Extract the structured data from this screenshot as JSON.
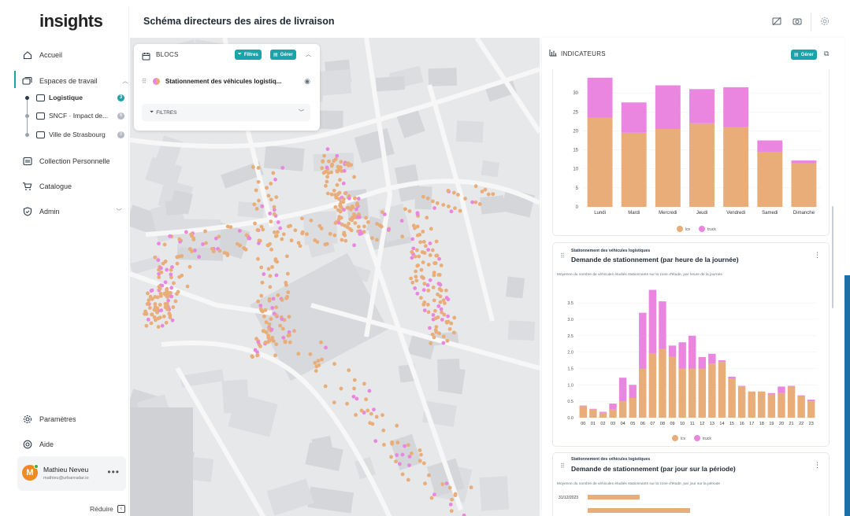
{
  "app": {
    "logo": "insights",
    "page_title": "Schéma directeurs des aires de livraison"
  },
  "sidebar": {
    "items": [
      {
        "label": "Accueil"
      },
      {
        "label": "Espaces de travail"
      },
      {
        "label": "Collection Personnelle"
      },
      {
        "label": "Catalogue"
      },
      {
        "label": "Admin"
      }
    ],
    "workspaces": [
      {
        "label": "Logistique",
        "badge": "3",
        "active": true
      },
      {
        "label": "SNCF · Impact de...",
        "badge": "6",
        "active": false
      },
      {
        "label": "Ville de Strasbourg",
        "badge": "0",
        "active": false
      }
    ],
    "bottom": [
      {
        "label": "Paramètres"
      },
      {
        "label": "Aide"
      }
    ],
    "user": {
      "initial": "M",
      "name": "Mathieu Neveu",
      "email": "mathieu@urbanradar.io"
    },
    "collapse_label": "Réduire"
  },
  "blocs": {
    "title": "BLOCS",
    "filters_btn": "Filtres",
    "manage_btn": "Gérer",
    "layer_name": "Stationnement des véhicules logistiq...",
    "filters_label": "FILTRES"
  },
  "indicators": {
    "title": "INDICATEURS",
    "manage_btn": "Gérer",
    "colors": {
      "lcv": "#e8ad78",
      "truck": "#ea86e0"
    },
    "legend": {
      "lcv": "lcv",
      "truck": "truck"
    },
    "card2": {
      "subtitle": "Stationnement des véhicules logistiques",
      "title": "Demande de stationnement (par heure de la journée)",
      "description": "Moyenne du nombre de véhicules étudiés stationnants sur la zone d'étude, par heure de la journée"
    },
    "card3": {
      "subtitle": "Stationnement des véhicules logistiques",
      "title": "Demande de stationnement (par jour sur la période)",
      "description": "Moyenne du nombre de véhicules étudiés stationnants sur la zone d'étude, par jour sur la période",
      "first_row_label": "31/12/2023",
      "first_row_value": 36
    }
  },
  "chart_data": [
    {
      "type": "bar",
      "stacked": true,
      "categories": [
        "Lundi",
        "Mardi",
        "Mercredi",
        "Jeudi",
        "Vendredi",
        "Samedi",
        "Dimanche"
      ],
      "series": [
        {
          "name": "lcv",
          "values": [
            23.5,
            19.5,
            20.5,
            22,
            21,
            14.5,
            11.5
          ]
        },
        {
          "name": "truck",
          "values": [
            10.5,
            8,
            11.5,
            9,
            10.5,
            3,
            0.7
          ]
        }
      ],
      "yticks": [
        0,
        5,
        10,
        15,
        20,
        25,
        30
      ],
      "ylim": [
        0,
        35
      ],
      "legend": "bottom"
    },
    {
      "type": "bar",
      "stacked": true,
      "categories": [
        "00",
        "01",
        "02",
        "03",
        "04",
        "05",
        "06",
        "07",
        "08",
        "09",
        "10",
        "11",
        "12",
        "13",
        "14",
        "15",
        "16",
        "17",
        "18",
        "19",
        "20",
        "21",
        "22",
        "23"
      ],
      "series": [
        {
          "name": "lcv",
          "values": [
            0.35,
            0.25,
            0.15,
            0.25,
            0.5,
            0.6,
            1.5,
            1.95,
            2.1,
            1.85,
            1.5,
            1.5,
            1.5,
            1.65,
            1.7,
            1.2,
            0.95,
            0.8,
            0.8,
            0.7,
            0.75,
            0.95,
            0.65,
            0.5
          ]
        },
        {
          "name": "truck",
          "values": [
            0.02,
            0.02,
            0.03,
            0.18,
            0.72,
            0.4,
            1.7,
            1.95,
            1.45,
            0.35,
            0.8,
            1.0,
            0.35,
            0.3,
            0.05,
            0.05,
            0.02,
            0.0,
            0.0,
            0.05,
            0.2,
            0.02,
            0.03,
            0.05
          ]
        }
      ],
      "yticks": [
        0.0,
        0.5,
        1.0,
        1.5,
        2.0,
        2.5,
        3.0,
        3.5
      ],
      "ylim": [
        0,
        3.6
      ],
      "legend": "bottom"
    }
  ]
}
